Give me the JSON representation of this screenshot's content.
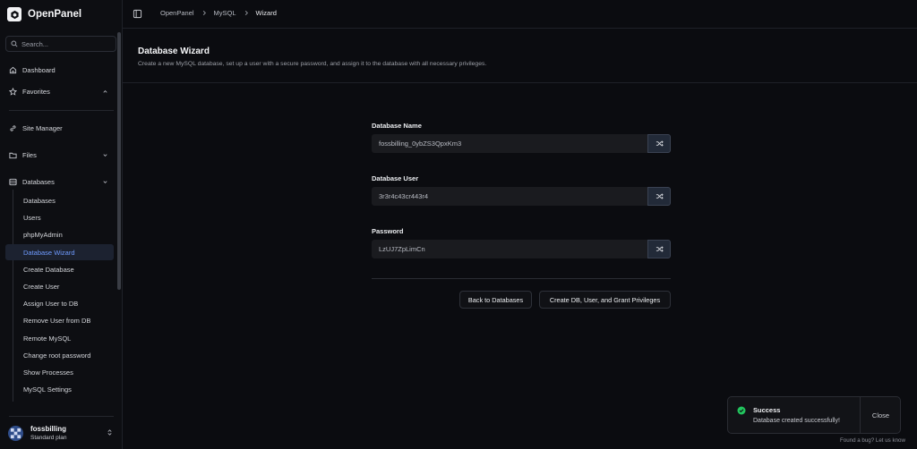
{
  "app": {
    "name": "OpenPanel"
  },
  "sidebar": {
    "search_placeholder": "Search...",
    "top_items": [
      {
        "label": "Dashboard",
        "icon": "home-icon"
      },
      {
        "label": "Favorites",
        "icon": "star-icon"
      }
    ],
    "items": [
      {
        "label": "Site Manager",
        "icon": "link-icon"
      },
      {
        "label": "Files",
        "icon": "folder-icon"
      },
      {
        "label": "Databases",
        "icon": "database-icon"
      }
    ],
    "database_subitems": [
      "Databases",
      "Users",
      "phpMyAdmin",
      "Database Wizard",
      "Create Database",
      "Create User",
      "Assign User to DB",
      "Remove User from DB",
      "Remote MySQL",
      "Change root password",
      "Show Processes",
      "MySQL Settings"
    ],
    "active_subitem": "Database Wizard",
    "user": {
      "name": "fossbilling",
      "plan": "Standard plan"
    }
  },
  "breadcrumb": [
    "OpenPanel",
    "MySQL",
    "Wizard"
  ],
  "page": {
    "title": "Database Wizard",
    "subtitle": "Create a new MySQL database, set up a user with a secure password, and assign it to the database with all necessary privileges."
  },
  "form": {
    "db_name": {
      "label": "Database Name",
      "value": "fossbilling_0ybZS3QpxKm3"
    },
    "db_user": {
      "label": "Database User",
      "value": "3r3r4c43cr443r4"
    },
    "password": {
      "label": "Password",
      "value": "LzUJ7ZpLimCn"
    },
    "back_label": "Back to Databases",
    "submit_label": "Create DB, User, and Grant Privileges"
  },
  "toast": {
    "title": "Success",
    "message": "Database created successfully!",
    "close_label": "Close"
  },
  "footer": {
    "bug_text": "Found a bug? Let us know"
  },
  "colors": {
    "accent": "#6f9bff",
    "success": "#22c55e",
    "background": "#0b0c10"
  }
}
